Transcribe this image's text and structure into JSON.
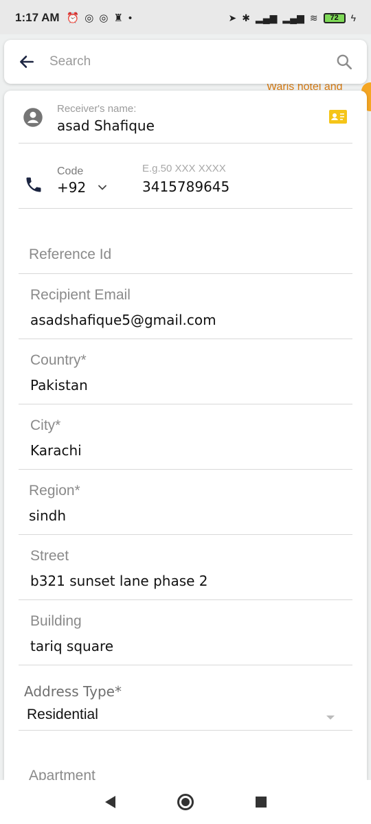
{
  "status_bar": {
    "time": "1:17 AM",
    "battery": "72",
    "left_icons": [
      "alarm-icon",
      "at-icon",
      "at-icon",
      "trophy-icon"
    ],
    "right_icons": [
      "location-icon",
      "bluetooth-icon",
      "signal-icon",
      "signal-icon",
      "wifi-icon",
      "battery-icon",
      "charging-icon"
    ]
  },
  "search": {
    "placeholder": "Search"
  },
  "map": {
    "label": "Waris hotel and"
  },
  "receiver": {
    "label": "Receiver's name:",
    "value": "asad Shafique"
  },
  "phone": {
    "code_label": "Code",
    "code_value": "+92",
    "number_placeholder": "E.g.50 XXX XXXX",
    "number_value": "3415789645"
  },
  "fields": {
    "reference_id": {
      "label": "Reference Id",
      "value": ""
    },
    "recipient_email": {
      "label": "Recipient Email",
      "value": "asadshafique5@gmail.com"
    },
    "country": {
      "label": "Country*",
      "value": "Pakistan"
    },
    "city": {
      "label": "City*",
      "value": "Karachi"
    },
    "region": {
      "label": "Region*",
      "value": "sindh"
    },
    "street": {
      "label": "Street",
      "value": "b321 sunset lane phase 2"
    },
    "building": {
      "label": "Building",
      "value": "tariq square"
    },
    "address_type": {
      "label": "Address Type*",
      "value": "Residential"
    },
    "apartment": {
      "label": "Apartment",
      "value": ""
    }
  },
  "colors": {
    "accent": "#f5c518",
    "map_label": "#d77a10",
    "icon_dark": "#1c2541"
  }
}
